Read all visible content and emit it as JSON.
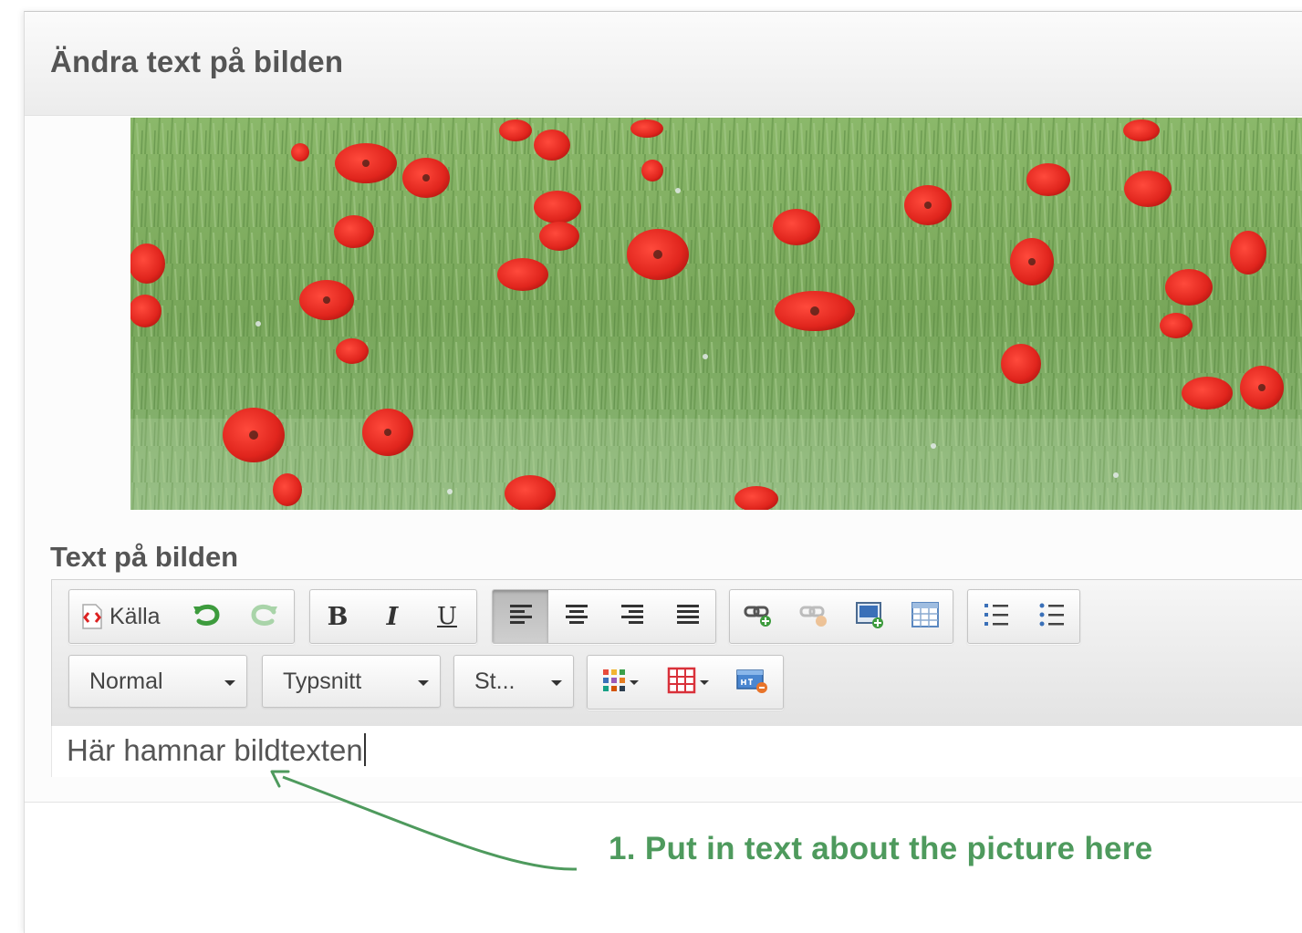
{
  "dialog": {
    "title": "Ändra text på bilden"
  },
  "image": {
    "subject": "field of red poppies in green grass"
  },
  "field": {
    "label": "Text på bilden"
  },
  "toolbar": {
    "row1": {
      "source_label": "Källa",
      "groups": [
        [
          "source-icon",
          "undo-icon",
          "redo-icon"
        ],
        [
          "bold-icon",
          "italic-icon",
          "underline-icon"
        ],
        [
          "align-left-icon",
          "align-center-icon",
          "align-right-icon",
          "align-justify-icon"
        ],
        [
          "link-icon",
          "unlink-icon",
          "image-icon",
          "table-icon"
        ],
        [
          "numbered-list-icon",
          "bulleted-list-icon"
        ]
      ],
      "active": "align-left-icon"
    },
    "row2": {
      "format_label": "Normal",
      "font_label": "Typsnitt",
      "size_label": "St...",
      "icons": [
        "text-color-icon",
        "table-grid-icon",
        "html-embed-icon"
      ]
    }
  },
  "editor": {
    "value": "Här hamnar bildtexten"
  },
  "annotation": {
    "text": "1. Put in text about the picture here",
    "color": "#4e9a5d"
  },
  "colors": {
    "title": "#555555",
    "active_button": "#b9b9b9",
    "poppy_red": "#e0251d",
    "grass_green": "#7faa5c"
  }
}
